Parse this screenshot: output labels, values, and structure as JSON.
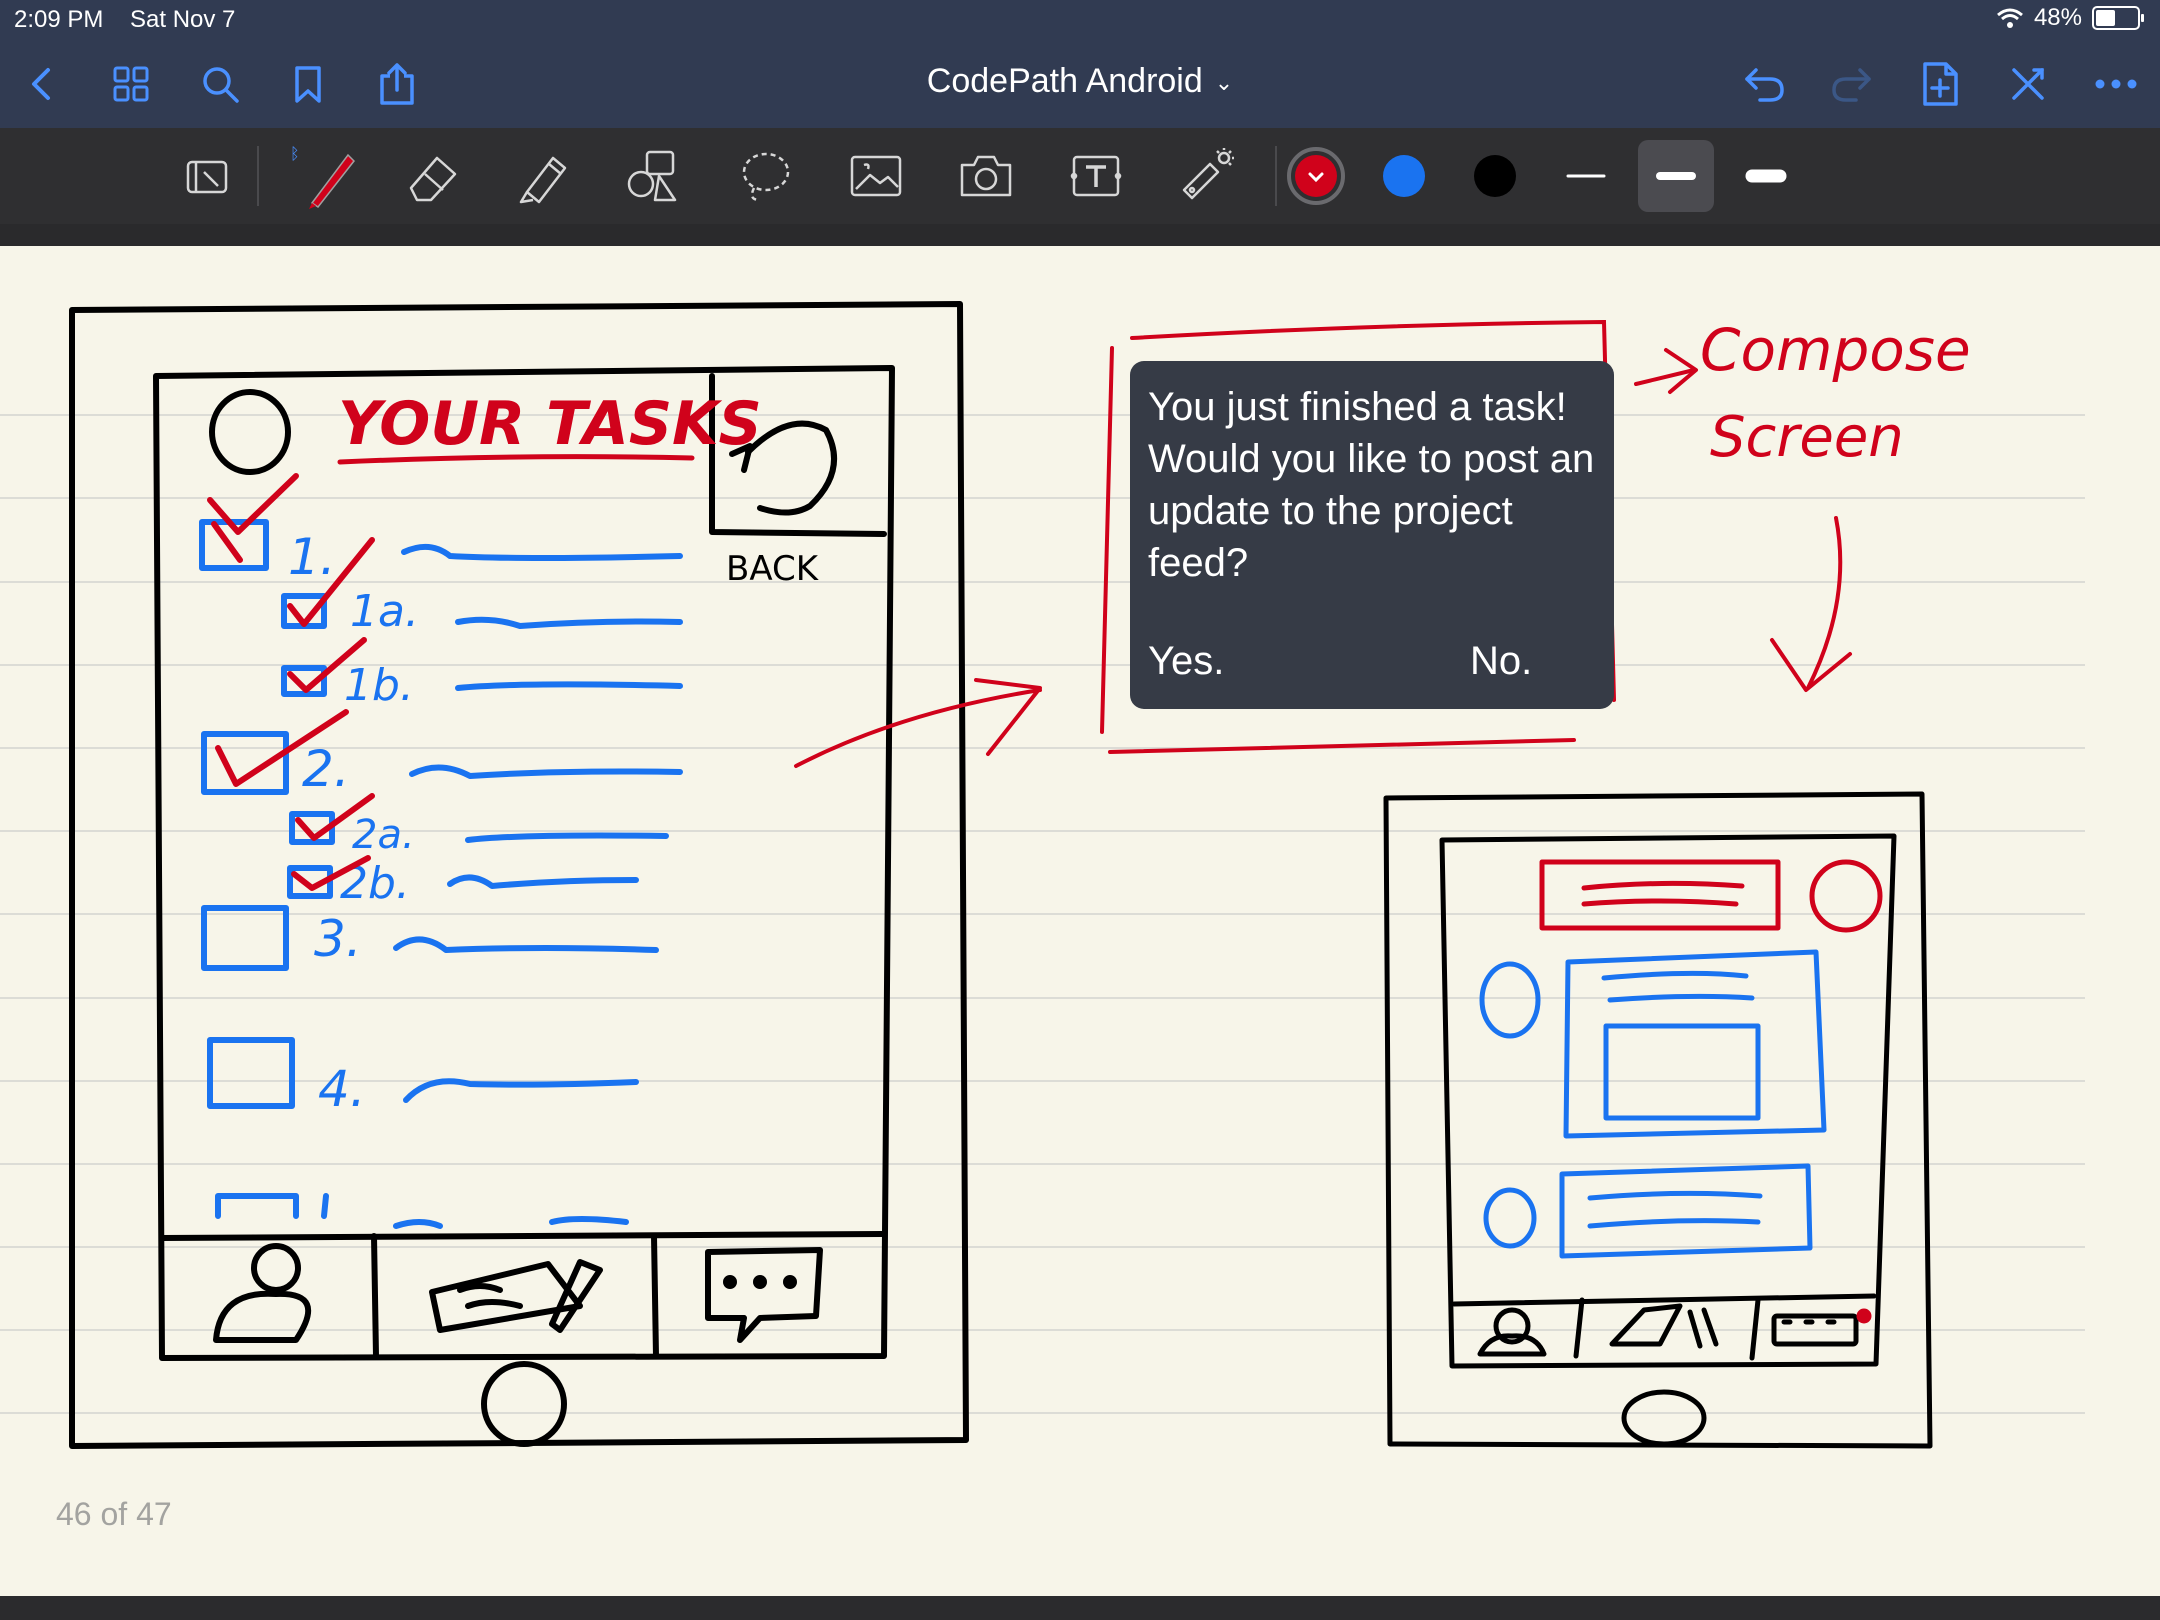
{
  "status_bar": {
    "time": "2:09 PM",
    "date": "Sat Nov 7",
    "battery": "48%",
    "battery_level": 0.48
  },
  "nav": {
    "title": "CodePath Android",
    "icons_left": [
      "back-chevron-icon",
      "thumbnails-grid-icon",
      "search-icon",
      "bookmark-icon",
      "share-icon"
    ],
    "icons_right": [
      "undo-icon",
      "redo-icon",
      "add-page-icon",
      "close-icon",
      "more-icon"
    ]
  },
  "toolbar": {
    "tools": [
      "reading-mode-icon",
      "pen-icon",
      "eraser-icon",
      "highlighter-icon",
      "shapes-icon",
      "lasso-icon",
      "image-icon",
      "camera-icon",
      "text-icon",
      "laser-pointer-icon"
    ],
    "selected_tool": "pen",
    "colors": [
      "#d0021b",
      "#1a73f0",
      "#000000"
    ],
    "selected_color": "#d0021b",
    "stroke_widths": [
      "thin",
      "medium",
      "thick"
    ],
    "selected_stroke": "medium"
  },
  "sketch": {
    "title": "YOUR TASKS",
    "back_label": "BACK",
    "tasks": [
      "1.",
      "1a.",
      "1b.",
      "2.",
      "2a.",
      "2b.",
      "3.",
      "4."
    ],
    "annotation_line1": "Compose",
    "annotation_line2": "Screen"
  },
  "popup": {
    "message": "You just finished a task! Would you like to post an update to the project feed?",
    "yes": "Yes.",
    "no": "No."
  },
  "page": {
    "counter": "46 of 47"
  }
}
